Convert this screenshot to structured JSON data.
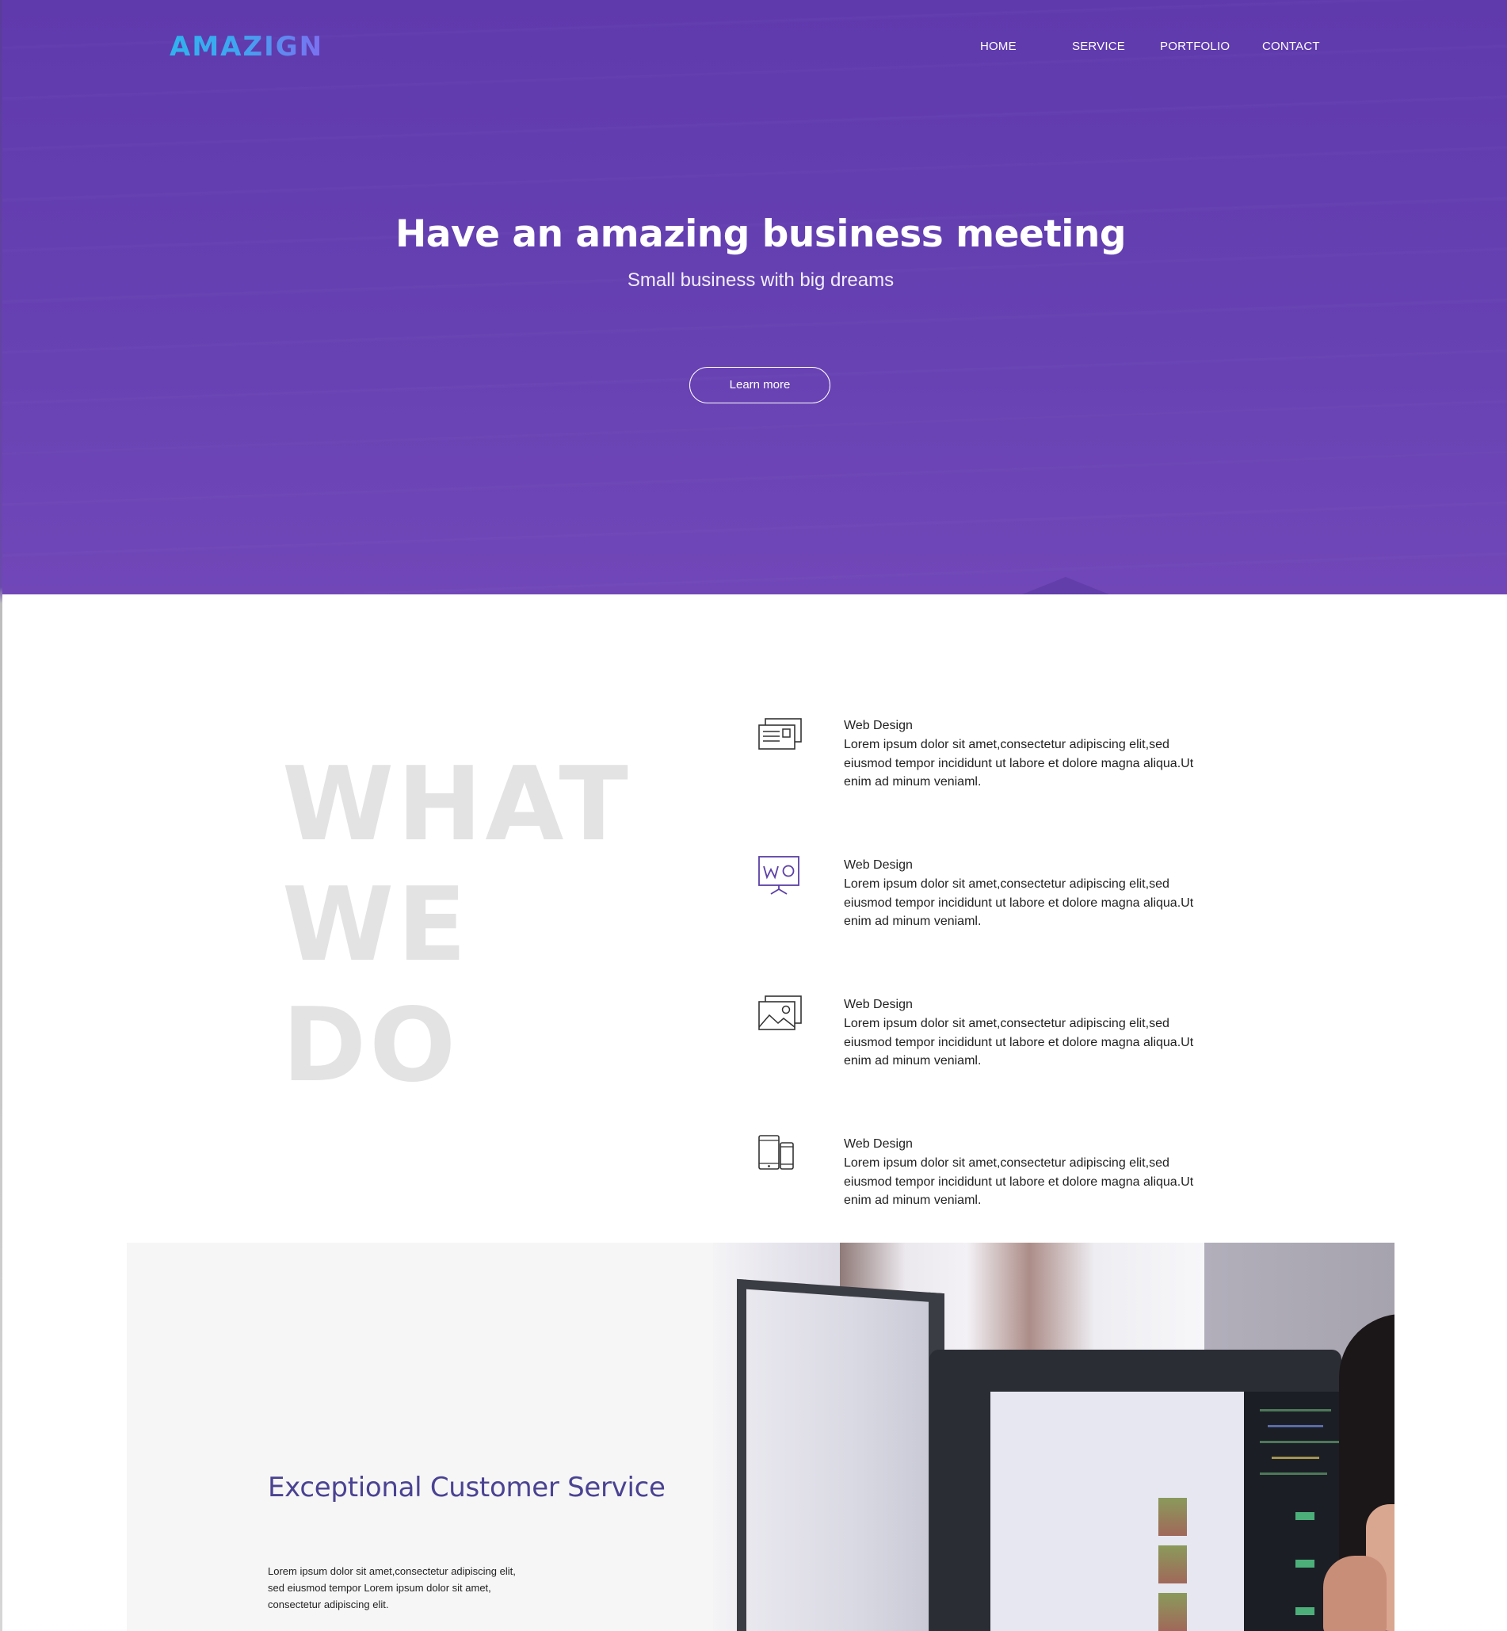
{
  "brand": {
    "logo_text": "AMAZIGN",
    "logo_colors": [
      "#2fb3ee",
      "#7d6ff0"
    ]
  },
  "nav": {
    "items": [
      {
        "label": "HOME"
      },
      {
        "label": "SERVICE"
      },
      {
        "label": "PORTFOLIO"
      },
      {
        "label": "CONTACT"
      }
    ]
  },
  "hero": {
    "title": "Have an amazing business meeting",
    "subtitle": "Small business with big dreams",
    "cta_label": "Learn more",
    "background_color": "#6641b2"
  },
  "what_we_do": {
    "heading_lines": [
      "WHAT",
      "WE",
      "DO"
    ],
    "services": [
      {
        "icon": "browser-windows-icon",
        "title": "Web Design",
        "description": "Lorem ipsum dolor sit amet,consectetur adipiscing elit,sed eiusmod tempor incididunt ut labore et dolore magna aliqua.Ut enim ad minum veniaml."
      },
      {
        "icon": "presentation-board-icon",
        "title": "Web Design",
        "description": "Lorem ipsum dolor sit amet,consectetur adipiscing elit,sed eiusmod tempor incididunt ut labore et dolore magna aliqua.Ut enim ad minum veniaml."
      },
      {
        "icon": "image-gallery-icon",
        "title": "Web Design",
        "description": "Lorem ipsum dolor sit amet,consectetur adipiscing elit,sed eiusmod tempor incididunt ut labore et dolore magna aliqua.Ut enim ad minum veniaml."
      },
      {
        "icon": "mobile-devices-icon",
        "title": "Web Design",
        "description": "Lorem ipsum dolor sit amet,consectetur adipiscing elit,sed eiusmod tempor incididunt ut labore et dolore magna aliqua.Ut enim ad minum veniaml."
      }
    ]
  },
  "customer_service": {
    "title": "Exceptional Customer Service",
    "body_lines": [
      "Lorem ipsum dolor sit amet,consectetur adipiscing elit,",
      "sed eiusmod tempor Lorem ipsum dolor sit amet,",
      "consectetur adipiscing elit."
    ],
    "title_color": "#4a4392"
  }
}
